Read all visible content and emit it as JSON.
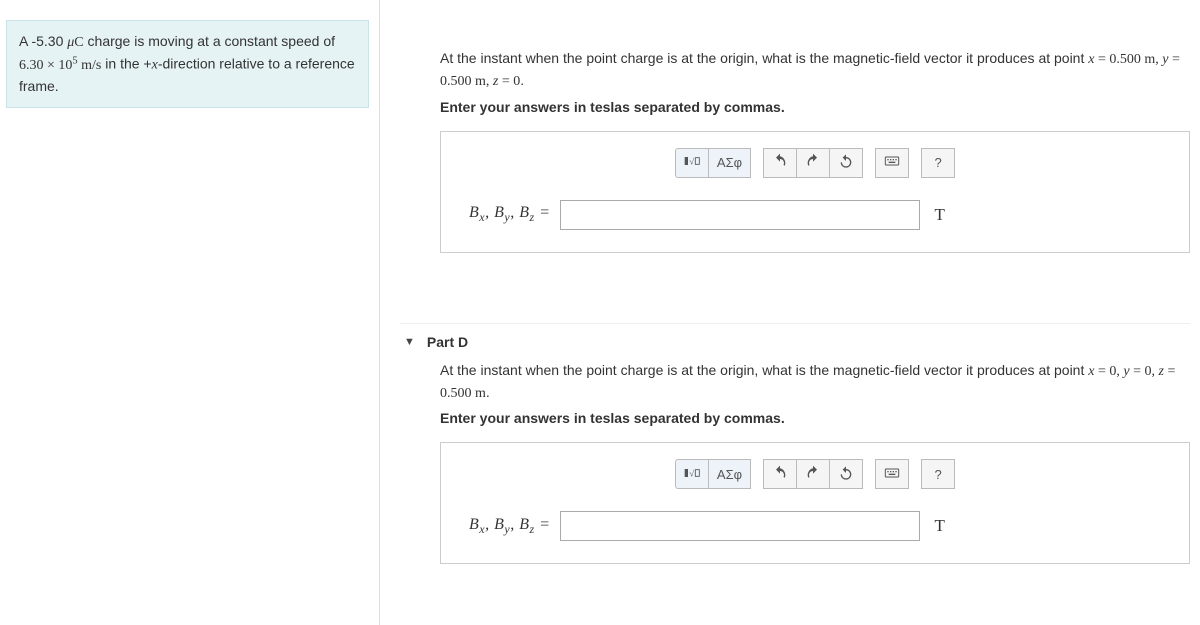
{
  "problem": {
    "html": "A -5.30 <span class='math'><span class='mi'>μ</span>C</span> charge is moving at a constant speed of <span class='math'>6.30 × 10<span class='sup'>5</span> m/s</span> in the +<span class='math mi'>x</span>-direction relative to a reference frame."
  },
  "partC": {
    "question_html": "At the instant when the point charge is at the origin, what is the magnetic-field vector it produces at point <span class='math'><span class='mi'>x</span> = 0.500 <span class='rm'>m</span>, <span class='mi'>y</span> = 0.500 <span class='rm'>m</span>, <span class='mi'>z</span> = 0</span>.",
    "instruction": "Enter your answers in teslas separated by commas.",
    "prompt_html": "B<span class='sub'>x</span>, B<span class='sub'>y</span>, B<span class='sub'>z</span> =",
    "unit": "T",
    "value": ""
  },
  "partD": {
    "label": "Part D",
    "question_html": "At the instant when the point charge is at the origin, what is the magnetic-field vector it produces at point <span class='math'><span class='mi'>x</span> = 0, <span class='mi'>y</span> = 0, <span class='mi'>z</span> = 0.500 <span class='rm'>m</span></span>.",
    "instruction": "Enter your answers in teslas separated by commas.",
    "prompt_html": "B<span class='sub'>x</span>, B<span class='sub'>y</span>, B<span class='sub'>z</span> =",
    "unit": "T",
    "value": ""
  },
  "toolbar": {
    "templates": "▮√□",
    "greek": "ΑΣφ",
    "help": "?"
  }
}
